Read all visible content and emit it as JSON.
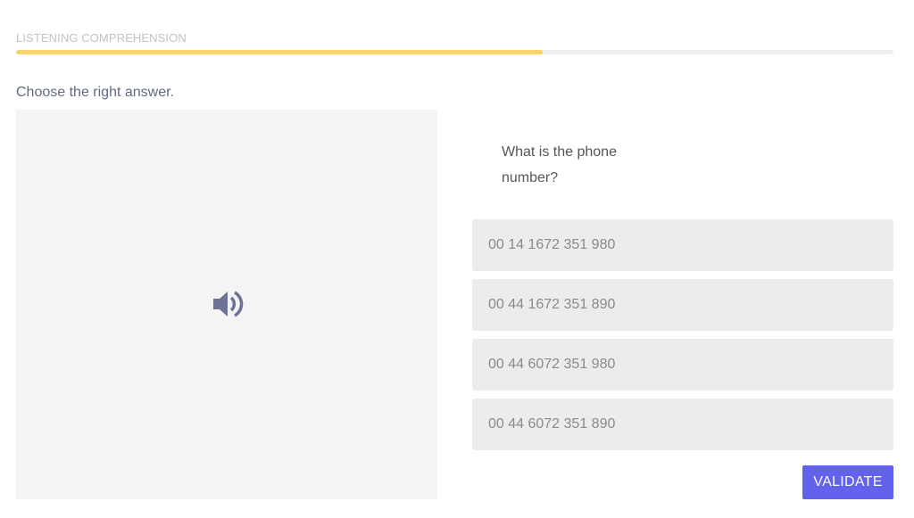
{
  "header": {
    "section_title": "LISTENING COMPREHENSION",
    "progress_percent": 60
  },
  "exercise": {
    "instruction": "Choose the right answer.",
    "audio_icon": "speaker-volume-icon",
    "question": "What is the phone number?",
    "answers": [
      "00 14 1672 351 980",
      "00 44 1672 351 890",
      "00 44 6072 351 980",
      "00 44 6072 351 890"
    ],
    "validate_label": "VALIDATE"
  },
  "colors": {
    "progress_fill": "#fbd36b",
    "progress_track": "#f0f0f0",
    "validate_button": "#6262ec",
    "audio_panel": "#f4f4f4",
    "answer_background": "#ececec",
    "speaker_icon": "#6e7393"
  }
}
